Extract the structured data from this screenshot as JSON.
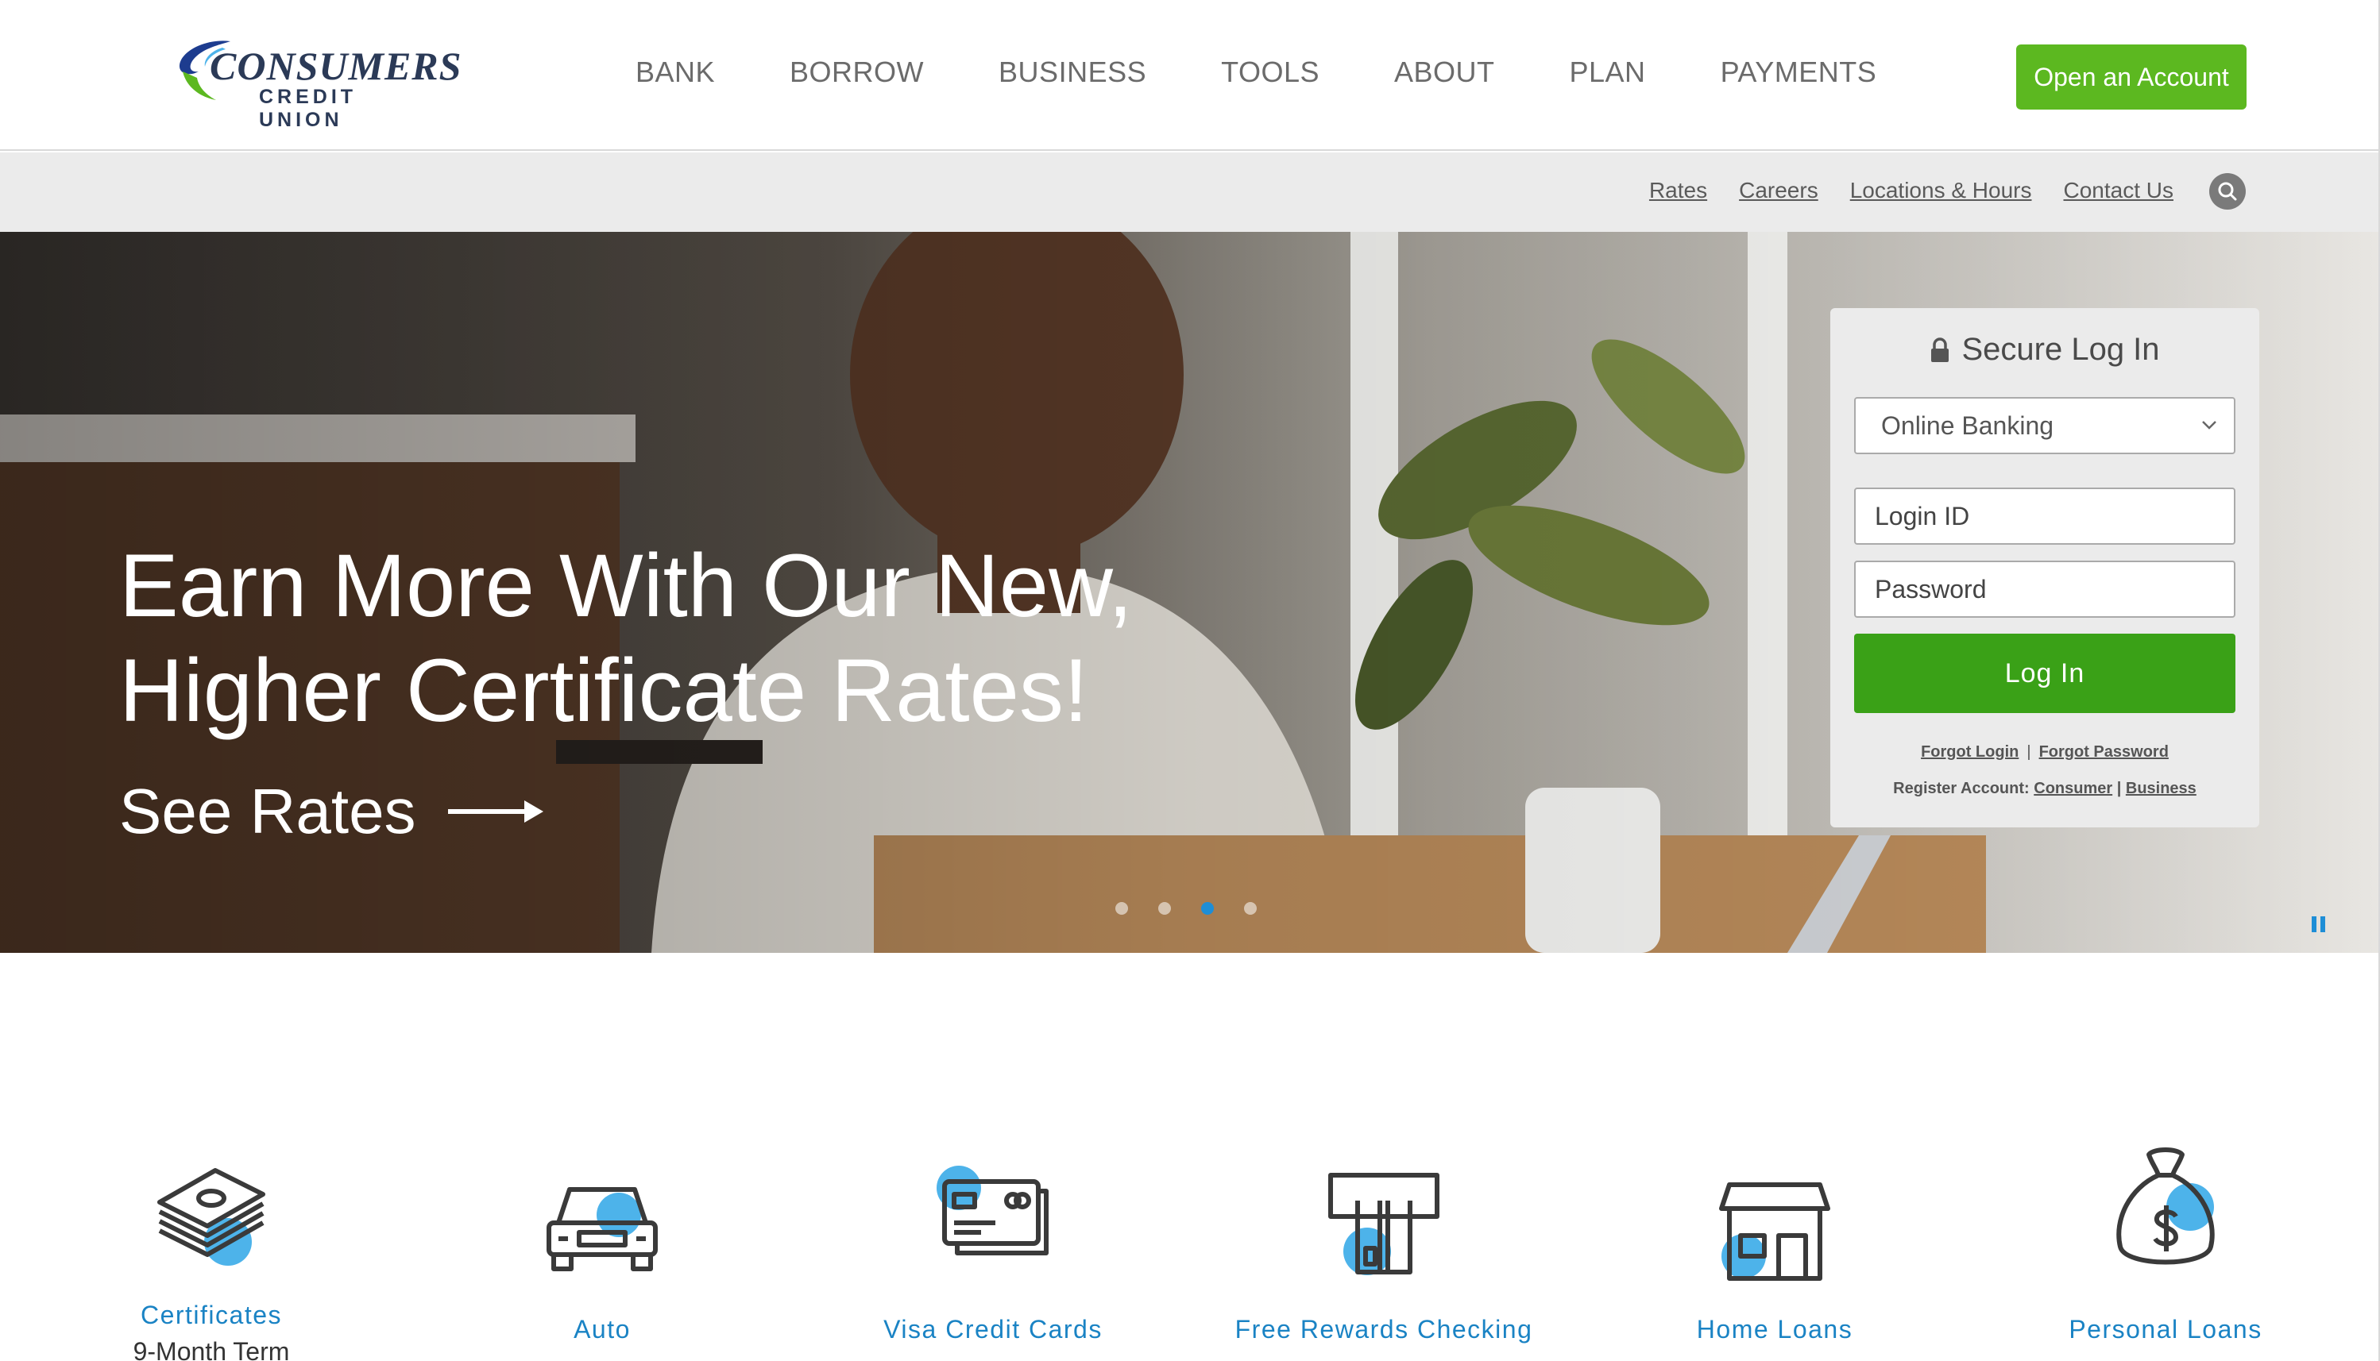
{
  "header": {
    "logo_text": "CONSUMERS",
    "logo_sub": "CREDIT UNION",
    "nav": [
      "BANK",
      "BORROW",
      "BUSINESS",
      "TOOLS",
      "ABOUT",
      "PLAN",
      "PAYMENTS"
    ],
    "open_account_label": "Open an Account"
  },
  "utility": {
    "links": [
      "Rates",
      "Careers",
      "Locations & Hours",
      "Contact Us"
    ],
    "search_icon": "search-icon"
  },
  "hero": {
    "title_line1": "Earn More With Our New,",
    "title_line2": "Higher Certificate Rates!",
    "cta": "See Rates",
    "slides_count": 4,
    "active_slide": 3
  },
  "login": {
    "title": "Secure Log In",
    "select_value": "Online Banking",
    "login_id_placeholder": "Login ID",
    "password_placeholder": "Password",
    "button_label": "Log In",
    "forgot_login": "Forgot Login",
    "forgot_password": "Forgot Password",
    "register_label": "Register Account:",
    "register_consumer": "Consumer",
    "register_business": "Business"
  },
  "tiles": [
    {
      "title": "Certificates",
      "subtitle": "9-Month Term",
      "icon": "money-stack-icon"
    },
    {
      "title": "Auto",
      "subtitle": "",
      "icon": "car-icon"
    },
    {
      "title": "Visa Credit Cards",
      "subtitle": "",
      "icon": "credit-card-icon"
    },
    {
      "title": "Free Rewards Checking",
      "subtitle": "",
      "icon": "atm-icon"
    },
    {
      "title": "Home Loans",
      "subtitle": "",
      "icon": "house-icon"
    },
    {
      "title": "Personal Loans",
      "subtitle": "",
      "icon": "money-bag-icon"
    }
  ],
  "colors": {
    "brand_green": "#5cb820",
    "login_green": "#3aa117",
    "brand_blue": "#1a83c4",
    "accent_blue": "#4db3ea"
  }
}
